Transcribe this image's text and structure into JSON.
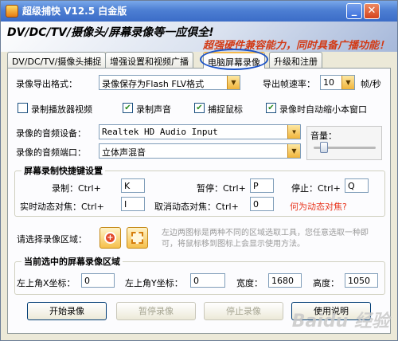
{
  "window": {
    "title": "超级捕快 V12.5 白金版"
  },
  "banner": {
    "line1": "DV/DC/TV/摄像头/屏幕录像等一应俱全!",
    "line2": "超强硬件兼容能力，同时具备广播功能！"
  },
  "tabs": [
    "DV/DC/TV/摄像头捕捉",
    "增强设置和视频广播",
    "电脑屏幕录像",
    "升级和注册"
  ],
  "form": {
    "export_format_label": "录像导出格式：",
    "export_format_value": "录像保存为Flash FLV格式",
    "fps_label": "导出帧速率：",
    "fps_value": "10",
    "fps_unit": "帧/秒",
    "chk_record_player": "录制播放器视频",
    "chk_record_sound": "录制声音",
    "chk_capture_mouse": "捕捉鼠标",
    "chk_auto_minimize": "录像时自动缩小本窗口",
    "audio_device_label": "录像的音频设备：",
    "audio_device_value": "Realtek HD Audio Input",
    "audio_port_label": "录像的音频端口：",
    "audio_port_value": "立体声混音",
    "volume_label": "音量："
  },
  "hotkeys": {
    "title": "屏幕录制快捷键设置",
    "record_label": "录制：Ctrl+",
    "record_key": "K",
    "pause_label": "暂停：Ctrl+",
    "pause_key": "P",
    "stop_label": "停止：Ctrl+",
    "stop_key": "Q",
    "dynamic_label": "实时动态对焦：Ctrl+",
    "dynamic_key": "I",
    "cancel_dynamic_label": "取消动态对焦：Ctrl+",
    "cancel_dynamic_key": "0",
    "what_is_dynamic": "何为动态对焦?"
  },
  "region_select": {
    "label": "请选择录像区域：",
    "hint": "左边两图标是两种不同的区域选取工具，您任意选取一种即可，将鼠标移到图标上会显示使用方法。"
  },
  "region": {
    "title": "当前选中的屏幕录像区域",
    "x_label": "左上角X坐标：",
    "x": "0",
    "y_label": "左上角Y坐标：",
    "y": "0",
    "width_label": "宽度：",
    "width": "1680",
    "height_label": "高度：",
    "height": "1050"
  },
  "buttons": {
    "start": "开始录像",
    "pause": "暂停录像",
    "stop": "停止录像",
    "help": "使用说明"
  },
  "watermark": "Baidu 经验"
}
